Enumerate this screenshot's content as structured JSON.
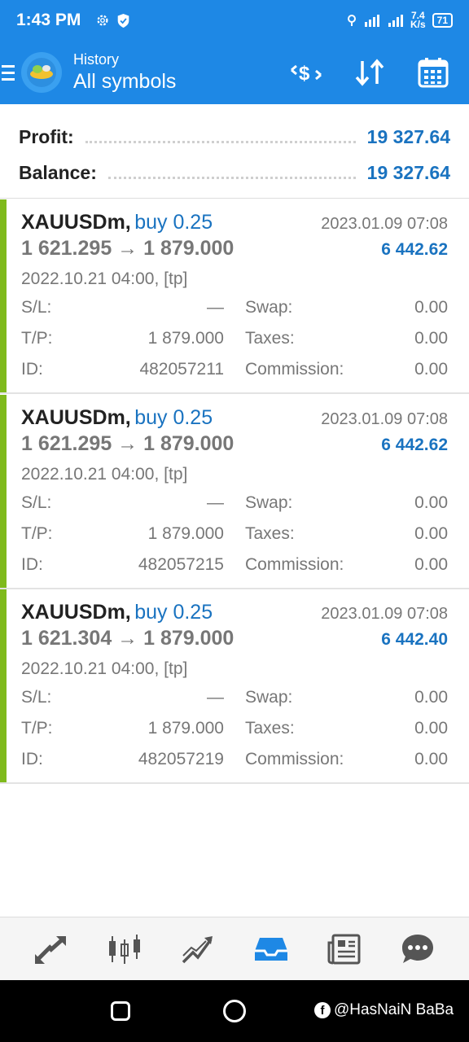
{
  "status_bar": {
    "time": "1:43 PM",
    "net_speed_value": "7.4",
    "net_speed_unit": "K/s",
    "battery": "71"
  },
  "app_bar": {
    "subtitle": "History",
    "title": "All symbols",
    "accent_color": "#1e88e5"
  },
  "summary": {
    "profit_label": "Profit:",
    "profit_value": "19 327.64",
    "balance_label": "Balance:",
    "balance_value": "19 327.64"
  },
  "deals": [
    {
      "symbol": "XAUUSDm,",
      "direction": "buy 0.25",
      "close_time": "2023.01.09 07:08",
      "prices": "1 621.295 → 1 879.000",
      "profit": "6 442.62",
      "open_info": "2022.10.21 04:00, [tp]",
      "sl_label": "S/L:",
      "sl_value": "—",
      "swap_label": "Swap:",
      "swap_value": "0.00",
      "tp_label": "T/P:",
      "tp_value": "1 879.000",
      "taxes_label": "Taxes:",
      "taxes_value": "0.00",
      "id_label": "ID:",
      "id_value": "482057211",
      "commission_label": "Commission:",
      "commission_value": "0.00"
    },
    {
      "symbol": "XAUUSDm,",
      "direction": "buy 0.25",
      "close_time": "2023.01.09 07:08",
      "prices": "1 621.295 → 1 879.000",
      "profit": "6 442.62",
      "open_info": "2022.10.21 04:00, [tp]",
      "sl_label": "S/L:",
      "sl_value": "—",
      "swap_label": "Swap:",
      "swap_value": "0.00",
      "tp_label": "T/P:",
      "tp_value": "1 879.000",
      "taxes_label": "Taxes:",
      "taxes_value": "0.00",
      "id_label": "ID:",
      "id_value": "482057215",
      "commission_label": "Commission:",
      "commission_value": "0.00"
    },
    {
      "symbol": "XAUUSDm,",
      "direction": "buy 0.25",
      "close_time": "2023.01.09 07:08",
      "prices": "1 621.304 → 1 879.000",
      "profit": "6 442.40",
      "open_info": "2022.10.21 04:00, [tp]",
      "sl_label": "S/L:",
      "sl_value": "—",
      "swap_label": "Swap:",
      "swap_value": "0.00",
      "tp_label": "T/P:",
      "tp_value": "1 879.000",
      "taxes_label": "Taxes:",
      "taxes_value": "0.00",
      "id_label": "ID:",
      "id_value": "482057219",
      "commission_label": "Commission:",
      "commission_value": "0.00"
    }
  ],
  "bottom_nav": [
    "quotes-icon",
    "chart-icon",
    "trade-icon",
    "history-icon",
    "news-icon",
    "chat-icon"
  ],
  "watermark": "@HasNaiN BaBa"
}
